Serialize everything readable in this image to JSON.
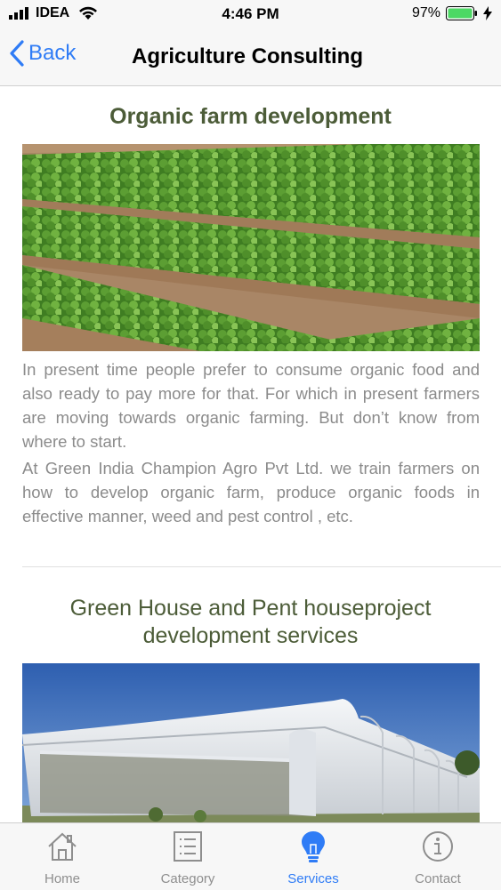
{
  "status": {
    "carrier": "IDEA",
    "time": "4:46 PM",
    "battery": "97%"
  },
  "nav": {
    "back_label": "Back",
    "title": "Agriculture Consulting"
  },
  "sections": [
    {
      "title": "Organic farm development",
      "paragraphs": [
        "In present time people prefer to consume organic food and also ready to pay more for that. For which in present farmers are moving towards organic farming. But don’t know from where to start.",
        "At Green India Champion Agro Pvt Ltd. we train farmers on how to develop organic farm, produce organic foods in effective manner, weed and pest control , etc."
      ]
    },
    {
      "title_line1": "Green House and Pent houseproject",
      "title_line2": "development services"
    }
  ],
  "tabs": [
    {
      "label": "Home",
      "icon": "house-icon"
    },
    {
      "label": "Category",
      "icon": "list-icon"
    },
    {
      "label": "Services",
      "icon": "lightbulb-icon"
    },
    {
      "label": "Contact",
      "icon": "info-icon"
    }
  ],
  "colors": {
    "accent": "#2f7cf6",
    "heading": "#4c5c38",
    "body_text": "#8b8b8b",
    "battery": "#4cd964"
  }
}
